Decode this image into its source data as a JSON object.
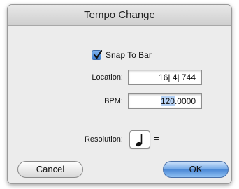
{
  "dialog": {
    "title": "Tempo Change"
  },
  "snap": {
    "label": "Snap To Bar",
    "checked": true
  },
  "location": {
    "label": "Location:",
    "value": "16| 4| 744"
  },
  "bpm": {
    "label": "BPM:",
    "value_selected": "120",
    "value_rest": ".0000"
  },
  "resolution": {
    "label": "Resolution:",
    "note_icon": "quarter-note-icon",
    "equals": "="
  },
  "buttons": {
    "cancel": "Cancel",
    "ok": "OK"
  },
  "colors": {
    "accent": "#4b88d6",
    "selection": "#b6d2f5"
  }
}
